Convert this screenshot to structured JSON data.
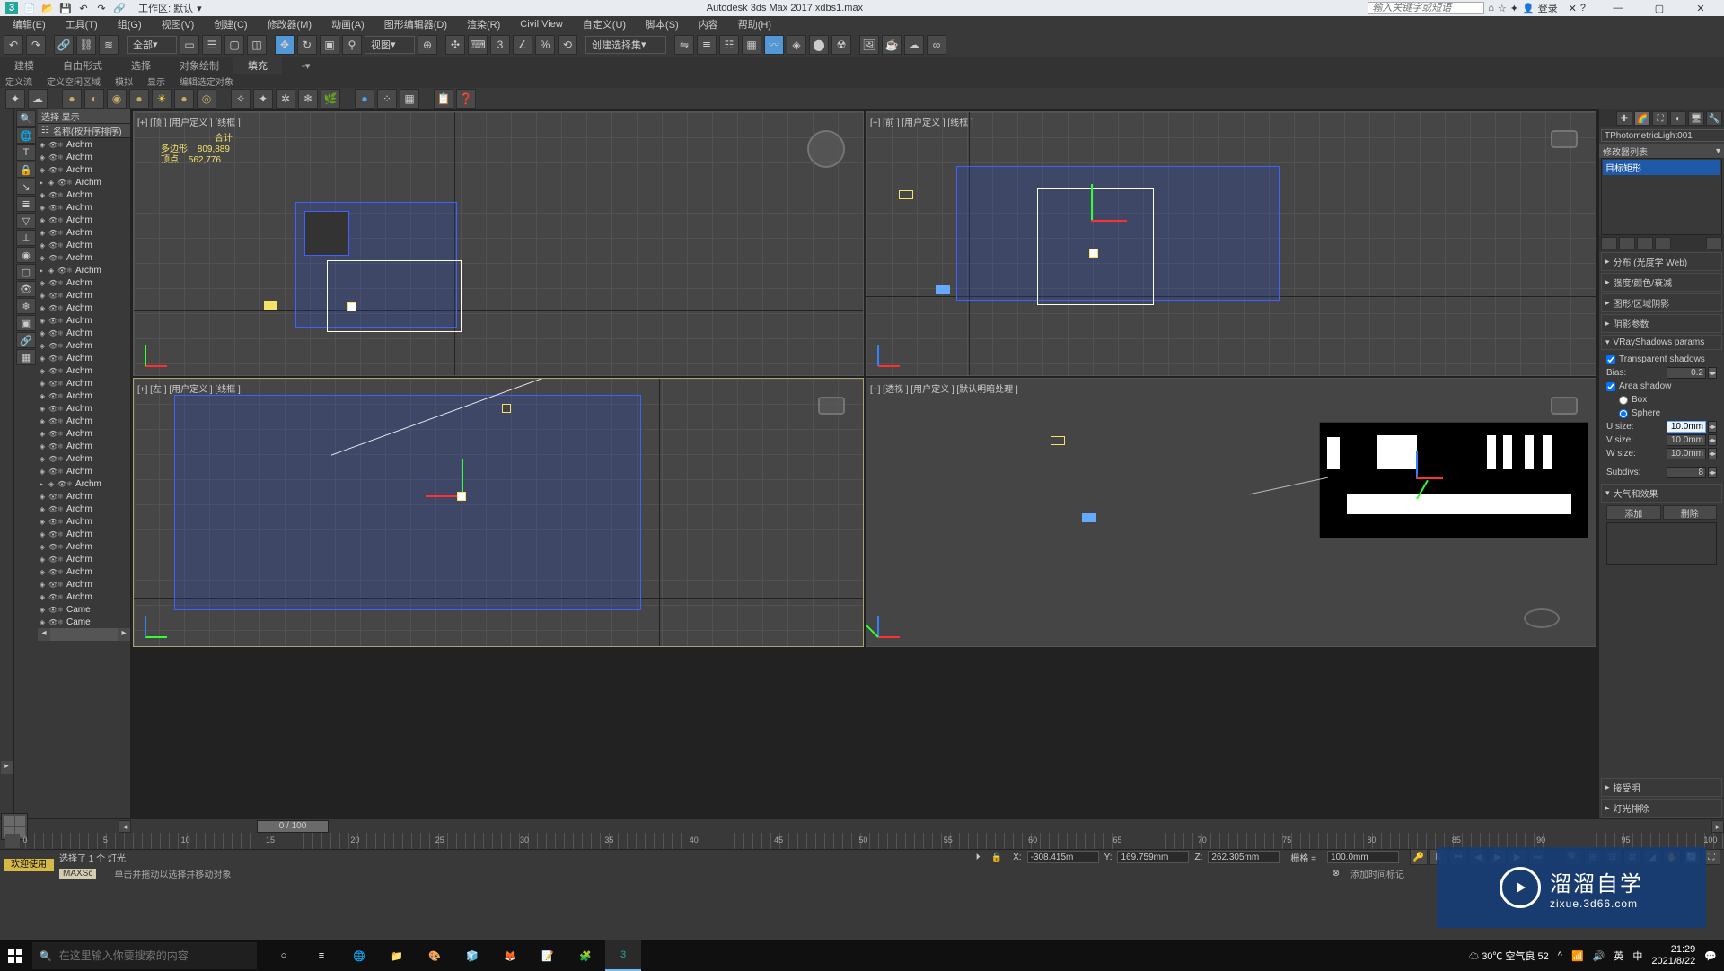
{
  "titlebar": {
    "workspace_label": "工作区: 默认",
    "title": "Autodesk 3ds Max 2017    xdbs1.max",
    "search_placeholder": "输入关键字或短语",
    "login": "登录"
  },
  "menu": [
    "编辑(E)",
    "工具(T)",
    "组(G)",
    "视图(V)",
    "创建(C)",
    "修改器(M)",
    "动画(A)",
    "图形编辑器(D)",
    "渲染(R)",
    "Civil View",
    "自定义(U)",
    "脚本(S)",
    "内容",
    "帮助(H)"
  ],
  "toolbar": {
    "filter_dd": "全部",
    "ref_dd": "视图",
    "sel_set_dd": "创建选择集"
  },
  "ribbon": {
    "tabs": [
      "建模",
      "自由形式",
      "选择",
      "对象绘制",
      "填充"
    ],
    "sub": [
      "定义流",
      "定义空闲区域",
      "模拟",
      "显示",
      "编辑选定对象"
    ]
  },
  "scene_panel": {
    "sel_disp": "选择    显示",
    "sort": "名称(按升序排序)",
    "items": [
      "Archm",
      "Archm",
      "Archm",
      "Archm",
      "Archm",
      "Archm",
      "Archm",
      "Archm",
      "Archm",
      "Archm",
      "Archm",
      "Archm",
      "Archm",
      "Archm",
      "Archm",
      "Archm",
      "Archm",
      "Archm",
      "Archm",
      "Archm",
      "Archm",
      "Archm",
      "Archm",
      "Archm",
      "Archm",
      "Archm",
      "Archm",
      "Archm",
      "Archm",
      "Archm",
      "Archm",
      "Archm",
      "Archm",
      "Archm",
      "Archm",
      "Archm",
      "Archm",
      "Came",
      "Came"
    ]
  },
  "viewports": {
    "top": "[+] [顶 ] [用户定义 ] [线框 ]",
    "front": "[+] [前 ] [用户定义 ] [线框 ]",
    "left": "[+] [左 ] [用户定义 ] [线框 ]",
    "persp": "[+] [透视 ] [用户定义 ] [默认明暗处理 ]",
    "stats_label1": "合计",
    "stats_poly_k": "多边形:",
    "stats_poly_v": "809,889",
    "stats_vert_k": "顶点:",
    "stats_vert_v": "562,776"
  },
  "cmd": {
    "obj_name": "TPhotometricLight001",
    "color_hex": "#ffe000",
    "modlist_header": "修改器列表",
    "mod_selected": "目标矩形",
    "rollouts": {
      "a": "分布 (光度学 Web)",
      "b": "强度/颜色/衰减",
      "c": "图形/区域阴影",
      "d": "阴影参数",
      "vray": "VRayShadows params",
      "atm": "大气和效果"
    },
    "vray": {
      "transp": "Transparent shadows",
      "bias_l": "Bias:",
      "bias_v": "0.2",
      "area": "Area shadow",
      "box": "Box",
      "sphere": "Sphere",
      "usize_l": "U size:",
      "vsize_l": "V size:",
      "wsize_l": "W size:",
      "usize_v": "10.0mm",
      "vsize_v": "10.0mm",
      "wsize_v": "10.0mm",
      "subdiv_l": "Subdivs:",
      "subdiv_v": "8"
    },
    "atm_btns": {
      "add": "添加",
      "del": "删除"
    },
    "extra1": "接受明",
    "extra2": "灯光排除"
  },
  "timeline": {
    "slider": "0 / 100",
    "ticks": [
      "0",
      "5",
      "10",
      "15",
      "20",
      "25",
      "30",
      "35",
      "40",
      "45",
      "50",
      "55",
      "60",
      "65",
      "70",
      "75",
      "80",
      "85",
      "90",
      "95",
      "100"
    ]
  },
  "status": {
    "welcome": "欢迎使用",
    "maxs": "MAXSc",
    "sel_info": "选择了 1 个 灯光",
    "hint": "单击并拖动以选择并移动对象",
    "x_l": "X:",
    "x_v": "-308.415m",
    "y_l": "Y:",
    "y_v": "169.759mm",
    "z_l": "Z:",
    "z_v": "262.305mm",
    "grid_l": "栅格 =",
    "grid_v": "100.0mm",
    "addtime": "添加时间标记"
  },
  "taskbar": {
    "search_placeholder": "在这里输入你要搜索的内容",
    "weather": "30℃ 空气良 52",
    "ime1": "英",
    "ime2": "中",
    "time": "21:29",
    "date": "2021/8/22"
  },
  "watermark": {
    "brand": "溜溜自学",
    "url": "zixue.3d66.com"
  }
}
